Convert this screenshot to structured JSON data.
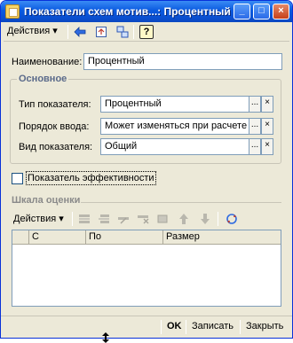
{
  "window": {
    "title": "Показатели схем мотив...: Процентный",
    "minimize_label": "_",
    "maximize_label": "□",
    "close_label": "×"
  },
  "toolbar": {
    "actions_label": "Действия ▾",
    "help_label": "?"
  },
  "form": {
    "name_label": "Наименование:",
    "name_value": "Процентный",
    "group_title": "Основное",
    "type_label": "Тип показателя:",
    "type_value": "Процентный",
    "order_label": "Порядок ввода:",
    "order_value": "Может изменяться при расчете",
    "kind_label": "Вид показателя:",
    "kind_value": "Общий",
    "select_button": "...",
    "clear_button": "×",
    "efficiency_label": "Показатель эффективности",
    "efficiency_checked": false
  },
  "scale": {
    "title": "Шкала оценки",
    "actions_label": "Действия ▾",
    "columns": [
      "С",
      "По",
      "Размер"
    ]
  },
  "footer": {
    "ok_label": "OK",
    "save_label": "Записать",
    "close_label": "Закрыть"
  }
}
